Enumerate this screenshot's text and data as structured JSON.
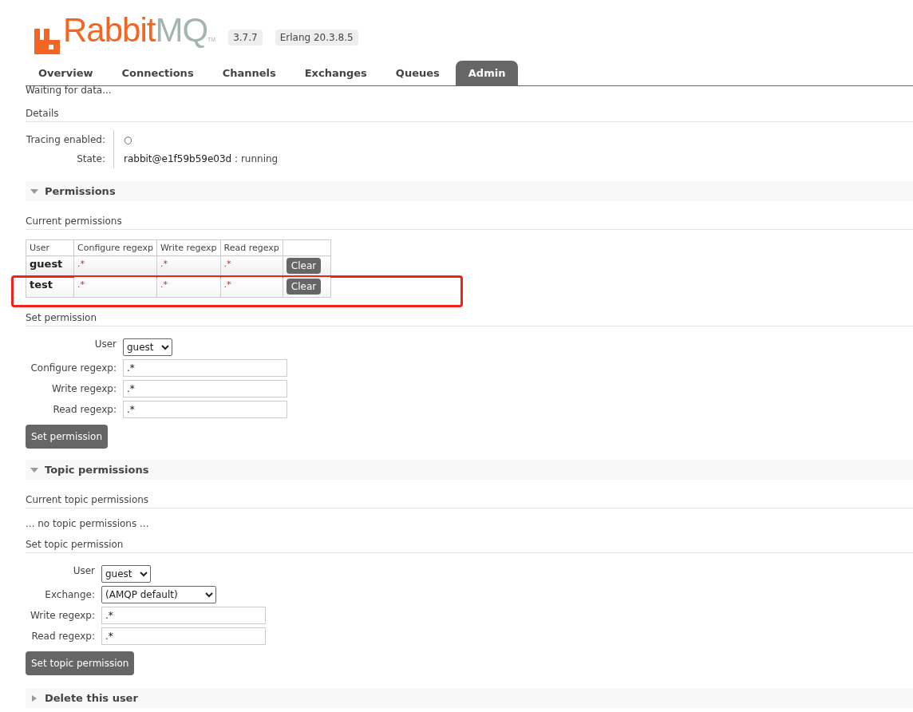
{
  "header": {
    "brand_primary": "Rabbit",
    "brand_secondary": "MQ",
    "trademark": "TM",
    "version": "3.7.7",
    "erlang": "Erlang 20.3.8.5"
  },
  "tabs": [
    {
      "label": "Overview",
      "selected": false
    },
    {
      "label": "Connections",
      "selected": false
    },
    {
      "label": "Channels",
      "selected": false
    },
    {
      "label": "Exchanges",
      "selected": false
    },
    {
      "label": "Queues",
      "selected": false
    },
    {
      "label": "Admin",
      "selected": true
    }
  ],
  "status": "Waiting for data...",
  "details": {
    "heading": "Details",
    "rows": [
      {
        "label": "Tracing enabled:",
        "value": "○"
      },
      {
        "label": "State:",
        "node": "rabbit@e1f59b59e03d",
        "value": " : running"
      }
    ]
  },
  "permissions": {
    "title": "Permissions",
    "expanded": true,
    "current_heading": "Current permissions",
    "columns": [
      "User",
      "Configure regexp",
      "Write regexp",
      "Read regexp"
    ],
    "rows": [
      {
        "user": "guest",
        "configure": ".*",
        "write": ".*",
        "read": ".*",
        "action": "Clear"
      },
      {
        "user": "test",
        "configure": ".*",
        "write": ".*",
        "read": ".*",
        "action": "Clear",
        "highlighted": true
      }
    ],
    "set_heading": "Set permission",
    "user": {
      "label": "User",
      "value": "guest"
    },
    "fields": [
      {
        "label": "Configure regexp:",
        "value": ".*"
      },
      {
        "label": "Write regexp:",
        "value": ".*"
      },
      {
        "label": "Read regexp:",
        "value": ".*"
      }
    ],
    "button": "Set permission"
  },
  "topic_permissions": {
    "title": "Topic permissions",
    "expanded": true,
    "current_heading": "Current topic permissions",
    "empty": "... no topic permissions ...",
    "set_heading": "Set topic permission",
    "user": {
      "label": "User",
      "value": "guest"
    },
    "exchange": {
      "label": "Exchange:",
      "value": "(AMQP default)"
    },
    "fields": [
      {
        "label": "Write regexp:",
        "value": ".*"
      },
      {
        "label": "Read regexp:",
        "value": ".*"
      }
    ],
    "button": "Set topic permission"
  },
  "delete_section": {
    "title": "Delete this user",
    "expanded": false
  }
}
